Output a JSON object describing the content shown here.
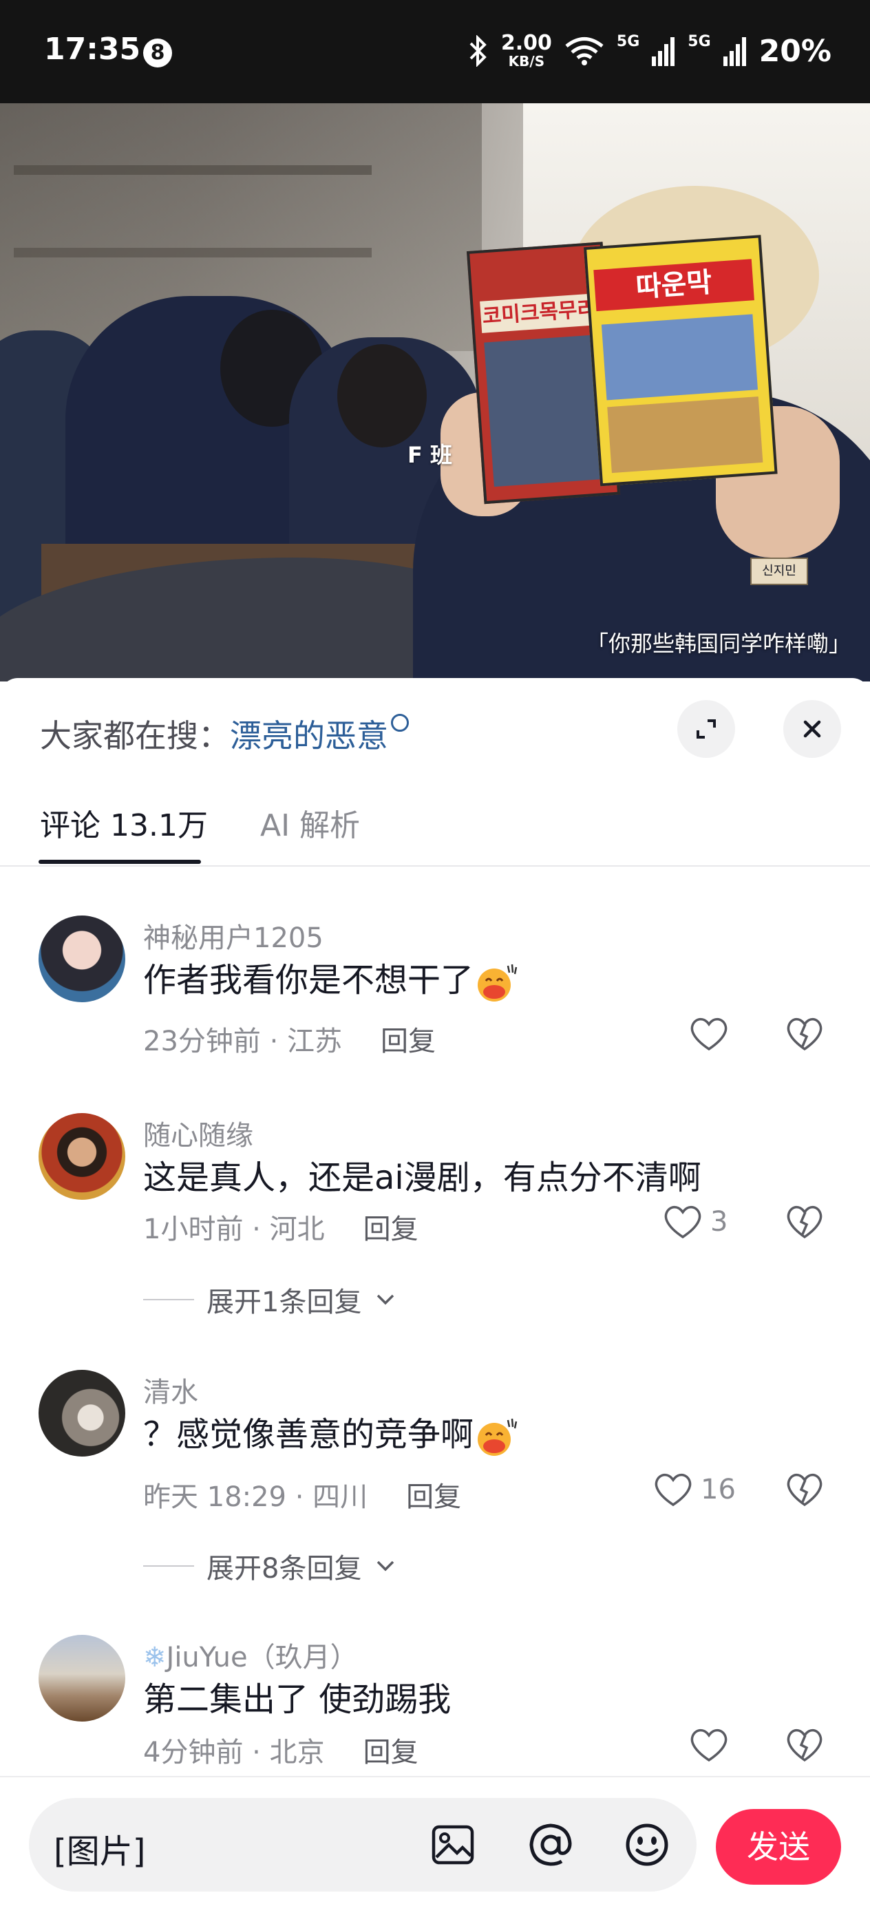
{
  "status_bar": {
    "time": "17:35",
    "notification_count": "8",
    "net_speed_value": "2.00",
    "net_speed_unit": "KB/S",
    "network_1": "5G",
    "network_2": "5G",
    "battery": "20%"
  },
  "video": {
    "center_label": "F 班",
    "caption": "「你那些韩国同学咋样嘞」",
    "comic_title": "따운막",
    "comic_back_title": "코미크목무리",
    "badge_text": "신지민"
  },
  "sheet": {
    "trending_prefix": "大家都在搜：",
    "trending_query": "漂亮的恶意",
    "tabs": [
      {
        "label": "评论 13.1万"
      },
      {
        "label": "AI 解析"
      }
    ]
  },
  "comments": [
    {
      "user": "神秘用户1205",
      "text": "作者我看你是不想干了",
      "time_location": "23分钟前 · 江苏",
      "reply": "回复",
      "likes": "",
      "emoji": true
    },
    {
      "user": "随心随缘",
      "text": "这是真人，还是ai漫剧，有点分不清啊",
      "time_location": "1小时前 · 河北",
      "reply": "回复",
      "likes": "3",
      "expand": "展开1条回复"
    },
    {
      "user": "清水",
      "text": "？感觉像善意的竞争啊",
      "time_location": "昨天 18:29 · 四川",
      "reply": "回复",
      "likes": "16",
      "emoji": true,
      "expand": "展开8条回复"
    },
    {
      "user": "JiuYue（玖月）",
      "text": "第二集出了 使劲踢我",
      "time_location": "4分钟前 · 北京",
      "reply": "回复",
      "likes": ""
    }
  ],
  "input_bar": {
    "placeholder": "[图片]",
    "send_label": "发送"
  },
  "colors": {
    "accent": "#fe2c55",
    "link": "#2c5e98",
    "secondary_text": "#8a8b91"
  }
}
